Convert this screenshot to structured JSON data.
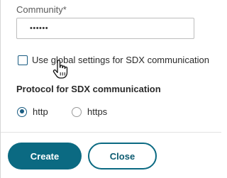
{
  "community": {
    "label": "Community*",
    "value": "••••••"
  },
  "global_settings": {
    "label": "Use global settings for SDX communication",
    "checked": false
  },
  "protocol": {
    "title": "Protocol for SDX communication",
    "options": [
      {
        "label": "http",
        "selected": true
      },
      {
        "label": "https",
        "selected": false
      }
    ]
  },
  "actions": {
    "create_label": "Create",
    "close_label": "Close"
  },
  "colors": {
    "accent": "#0b6a82",
    "border": "#bdbdbd"
  },
  "icons": {
    "cursor": "hand-pointer-icon"
  }
}
